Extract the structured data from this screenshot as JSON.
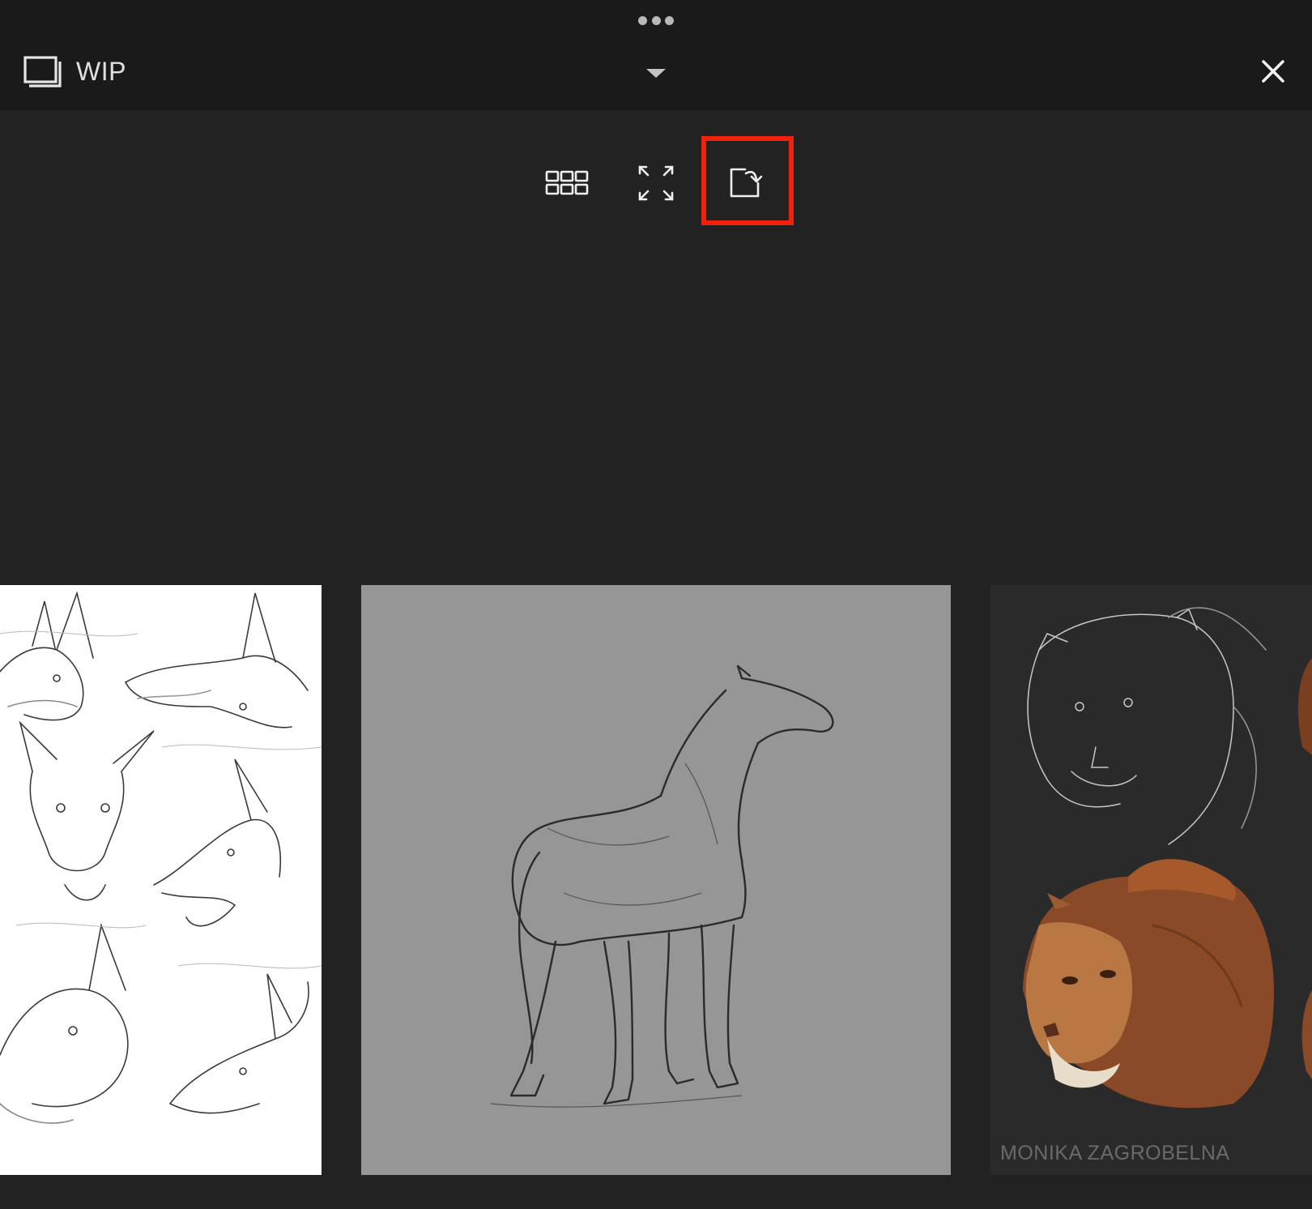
{
  "header": {
    "album_title": "WIP",
    "icons": {
      "album": "album-stack-icon",
      "dropdown": "chevron-down-icon",
      "close": "close-icon",
      "drag": "drag-handle-icon"
    }
  },
  "toolbar": {
    "buttons": [
      {
        "name": "grid-view",
        "icon": "grid-icon"
      },
      {
        "name": "fullscreen",
        "icon": "expand-icon"
      },
      {
        "name": "export",
        "icon": "export-icon",
        "highlighted": true
      }
    ],
    "highlight_color": "#f0220e"
  },
  "gallery": {
    "items": [
      {
        "subject": "dog head sketches",
        "background": "#ffffff"
      },
      {
        "subject": "horse sketch",
        "background": "#969696"
      },
      {
        "subject": "lion studies",
        "background": "#2a2a2a",
        "watermark": "MONIKA ZAGROBELNA"
      }
    ]
  }
}
